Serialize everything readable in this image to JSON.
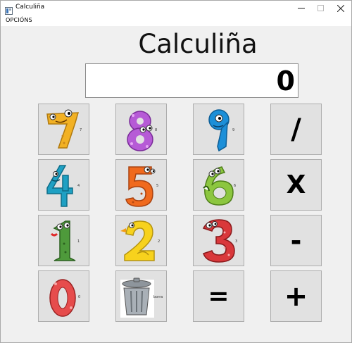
{
  "window": {
    "title": "Calculiña"
  },
  "menu": {
    "options_label": "OPCIÓNS"
  },
  "app": {
    "heading": "Calculiña"
  },
  "display": {
    "value": "0"
  },
  "keys": {
    "k7": {
      "digit": "7",
      "sub": "7"
    },
    "k8": {
      "digit": "8",
      "sub": "8"
    },
    "k9": {
      "digit": "9",
      "sub": "9"
    },
    "k4": {
      "digit": "4",
      "sub": "4"
    },
    "k5": {
      "digit": "5",
      "sub": "5"
    },
    "k6": {
      "digit": "6",
      "sub": "6"
    },
    "k1": {
      "digit": "1",
      "sub": "1"
    },
    "k2": {
      "digit": "2",
      "sub": "2"
    },
    "k3": {
      "digit": "3",
      "sub": "3"
    },
    "k0": {
      "digit": "0",
      "sub": "0"
    },
    "clear": {
      "sub": "borra"
    },
    "divide": {
      "label": "/"
    },
    "multiply": {
      "label": "X"
    },
    "subtract": {
      "label": "-"
    },
    "equals": {
      "label": "="
    },
    "add": {
      "label": "+"
    }
  },
  "colors": {
    "seven": "#f2b124",
    "eight": "#b65bd6",
    "nine": "#1c8fd8",
    "four": "#1ea0c3",
    "five": "#f06a1e",
    "six": "#8cc63f",
    "one": "#4e9a3b",
    "two": "#f7d21d",
    "three": "#d9383b",
    "zero": "#e64c4c"
  }
}
